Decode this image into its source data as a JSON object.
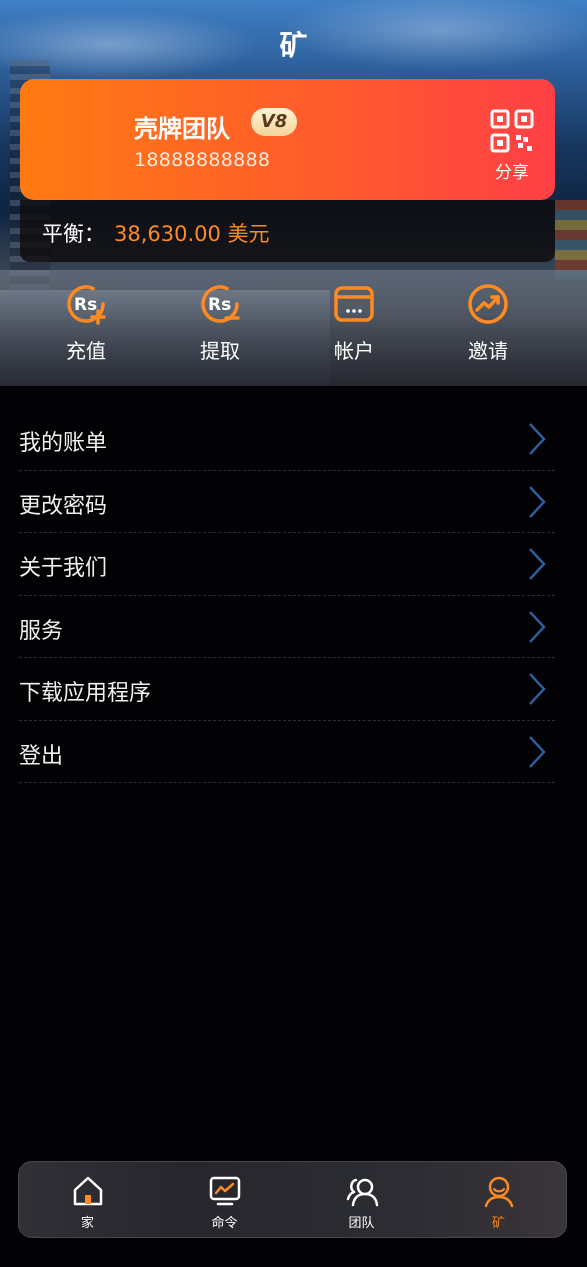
{
  "header": {
    "title": "矿"
  },
  "profile": {
    "name": "壳牌团队",
    "vip_level": "V8",
    "phone": "18888888888",
    "share_label": "分享"
  },
  "balance": {
    "label": "平衡：",
    "value": "38,630.00 美元"
  },
  "actions": [
    {
      "label": "充值",
      "icon": "rupee-plus-icon"
    },
    {
      "label": "提取",
      "icon": "rupee-minus-icon"
    },
    {
      "label": "帐户",
      "icon": "card-icon"
    },
    {
      "label": "邀请",
      "icon": "trend-icon"
    }
  ],
  "menu": [
    {
      "label": "我的账单"
    },
    {
      "label": "更改密码"
    },
    {
      "label": "关于我们"
    },
    {
      "label": "服务"
    },
    {
      "label": "下载应用程序"
    },
    {
      "label": "登出"
    }
  ],
  "tabbar": [
    {
      "label": "家",
      "icon": "home-icon",
      "active": false
    },
    {
      "label": "命令",
      "icon": "monitor-chart-icon",
      "active": false
    },
    {
      "label": "团队",
      "icon": "team-icon",
      "active": false
    },
    {
      "label": "矿",
      "icon": "user-icon",
      "active": true
    }
  ],
  "colors": {
    "accent": "#ff8a1f",
    "card_start": "#ff7a12",
    "card_end": "#ff3f45",
    "chevron": "#2f5d9a"
  }
}
